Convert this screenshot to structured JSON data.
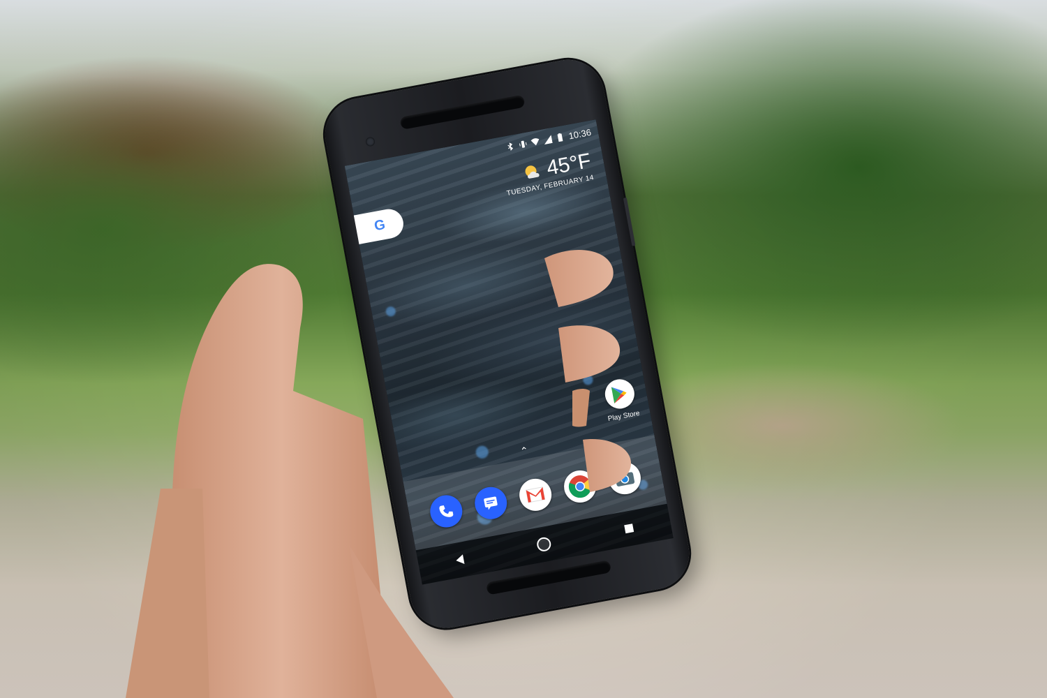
{
  "status_bar": {
    "time": "10:36"
  },
  "weather": {
    "temperature": "45°F",
    "date": "TUESDAY, FEBRUARY 14"
  },
  "google_widget": {
    "letter": "G"
  },
  "desktop_apps": [
    {
      "label": "Play Store",
      "icon": "play-store-icon"
    }
  ],
  "dock": {
    "apps": [
      {
        "name": "phone",
        "icon": "phone-icon",
        "color": "#2962ff"
      },
      {
        "name": "messages",
        "icon": "messages-icon",
        "color": "#2962ff"
      },
      {
        "name": "gmail",
        "icon": "gmail-icon",
        "color": "#ea4335"
      },
      {
        "name": "chrome",
        "icon": "chrome-icon",
        "color": "#4285f4"
      },
      {
        "name": "camera",
        "icon": "camera-icon",
        "color": "#1e88e5"
      }
    ]
  },
  "navigation": {
    "buttons": [
      "back",
      "home",
      "recents"
    ]
  },
  "colors": {
    "screen_bg": "#1f2a33",
    "phone_body": "#1b1c20",
    "skin": "#d8a68d"
  }
}
